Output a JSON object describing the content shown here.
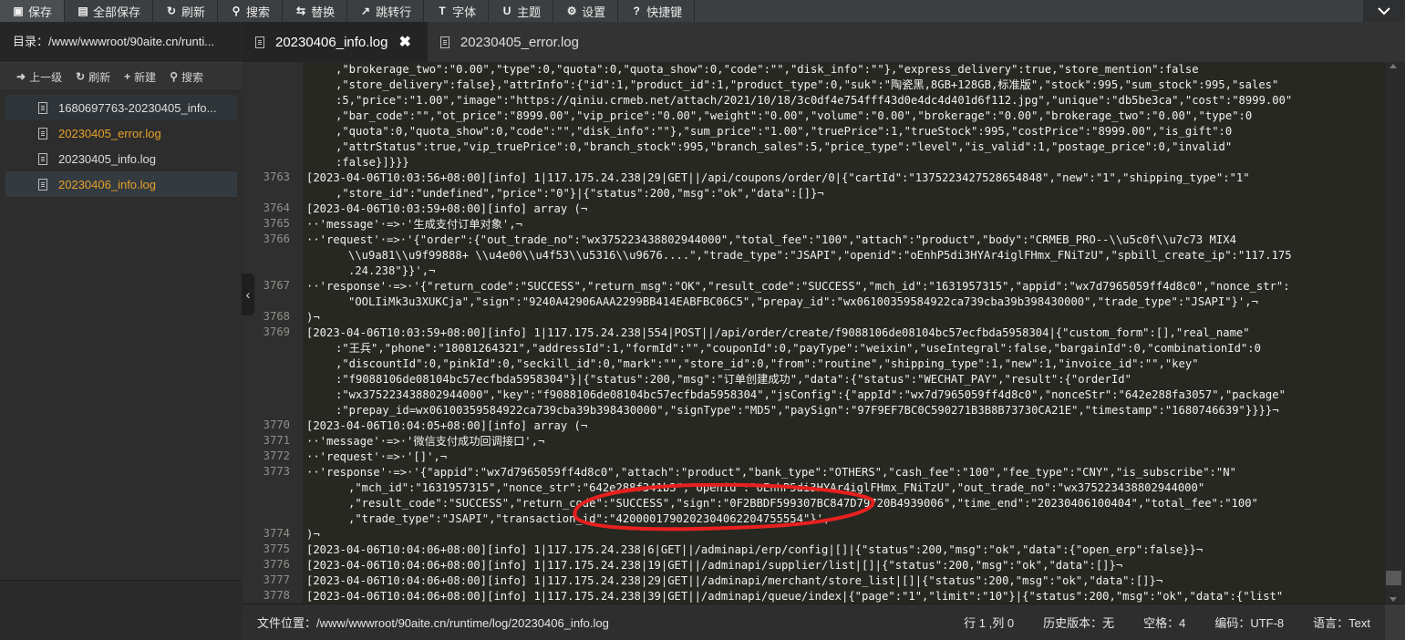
{
  "toolbar": {
    "buttons": [
      {
        "icon": "save-icon",
        "label": "保存"
      },
      {
        "icon": "save-all-icon",
        "label": "全部保存"
      },
      {
        "icon": "refresh-icon",
        "label": "刷新"
      },
      {
        "icon": "search-icon",
        "label": "搜索"
      },
      {
        "icon": "replace-icon",
        "label": "替换"
      },
      {
        "icon": "goto-line-icon",
        "label": "跳转行"
      },
      {
        "icon": "font-icon",
        "label": "字体"
      },
      {
        "icon": "theme-icon",
        "label": "主题"
      },
      {
        "icon": "settings-icon",
        "label": "设置"
      },
      {
        "icon": "help-icon",
        "label": "快捷键"
      }
    ]
  },
  "sidebar": {
    "dir_label": "目录：/www/wwwroot/90aite.cn/runti...",
    "actions": [
      {
        "icon": "up-arrow-icon",
        "label": "上一级"
      },
      {
        "icon": "refresh-icon",
        "label": "刷新"
      },
      {
        "icon": "plus-icon",
        "label": "新建"
      },
      {
        "icon": "search-icon",
        "label": "搜索"
      }
    ],
    "files": [
      {
        "name": "1680697763-20230405_info...",
        "highlight": false
      },
      {
        "name": "20230405_error.log",
        "highlight": true
      },
      {
        "name": "20230405_info.log",
        "highlight": false
      },
      {
        "name": "20230406_info.log",
        "highlight": true
      }
    ]
  },
  "tabs": [
    {
      "label": "20230406_info.log",
      "active": true,
      "close": "✖"
    },
    {
      "label": "20230405_error.log",
      "active": false
    }
  ],
  "editor": {
    "line_numbers": [
      "3763",
      "3764",
      "3765",
      "3766",
      "3767",
      "3768",
      "3769",
      "3770",
      "3771",
      "3772",
      "3773",
      "3774",
      "3775",
      "3776",
      "3777",
      "3778"
    ],
    "lines": [
      ",\"brokerage_two\":\"0.00\",\"type\":0,\"quota\":0,\"quota_show\":0,\"code\":\"\",\"disk_info\":\"\"},\"express_delivery\":true,\"store_mention\":false",
      ",\"store_delivery\":false},\"attrInfo\":{\"id\":1,\"product_id\":1,\"product_type\":0,\"suk\":\"陶瓷黑,8GB+128GB,标准版\",\"stock\":995,\"sum_stock\":995,\"sales\"",
      ":5,\"price\":\"1.00\",\"image\":\"https://qiniu.crmeb.net/attach/2021/10/18/3c0df4e754fff43d0e4dc4d401d6f112.jpg\",\"unique\":\"db5be3ca\",\"cost\":\"8999.00\"",
      ",\"bar_code\":\"\",\"ot_price\":\"8999.00\",\"vip_price\":\"0.00\",\"weight\":\"0.00\",\"volume\":\"0.00\",\"brokerage\":\"0.00\",\"brokerage_two\":\"0.00\",\"type\":0",
      ",\"quota\":0,\"quota_show\":0,\"code\":\"\",\"disk_info\":\"\"},\"sum_price\":\"1.00\",\"truePrice\":1,\"trueStock\":995,\"costPrice\":\"8999.00\",\"is_gift\":0",
      ",\"attrStatus\":true,\"vip_truePrice\":0,\"branch_stock\":995,\"branch_sales\":5,\"price_type\":\"level\",\"is_valid\":1,\"postage_price\":0,\"invalid\"",
      ":false}]}}}",
      "[2023-04-06T10:03:56+08:00][info] 1|117.175.24.238|29|GET||/api/coupons/order/0|{\"cartId\":\"1375223427528654848\",\"new\":\"1\",\"shipping_type\":\"1\"",
      ",\"store_id\":\"undefined\",\"price\":\"0\"}|{\"status\":200,\"msg\":\"ok\",\"data\":[]}¬",
      "[2023-04-06T10:03:59+08:00][info] array (¬",
      "··'message'·=>·'生成支付订单对象',¬",
      "··'request'·=>·'{\"order\":{\"out_trade_no\":\"wx375223438802944000\",\"total_fee\":\"100\",\"attach\":\"product\",\"body\":\"CRMEB_PRO--\\\\u5c0f\\\\u7c73 MIX4",
      "\\\\u9a81\\\\u9f99888+ \\\\u4e00\\\\u4f53\\\\u5316\\\\u9676....\",\"trade_type\":\"JSAPI\",\"openid\":\"oEnhP5di3HYAr4iglFHmx_FNiTzU\",\"spbill_create_ip\":\"117.175",
      ".24.238\"}}',¬",
      "··'response'·=>·'{\"return_code\":\"SUCCESS\",\"return_msg\":\"OK\",\"result_code\":\"SUCCESS\",\"mch_id\":\"1631957315\",\"appid\":\"wx7d7965059ff4d8c0\",\"nonce_str\":",
      "\"OOLIiMk3u3XUKCja\",\"sign\":\"9240A42906AAA2299BB414EABFBC06C5\",\"prepay_id\":\"wx06100359584922ca739cba39b398430000\",\"trade_type\":\"JSAPI\"}',¬",
      ")¬",
      "[2023-04-06T10:03:59+08:00][info] 1|117.175.24.238|554|POST||/api/order/create/f9088106de08104bc57ecfbda5958304|{\"custom_form\":[],\"real_name\"",
      ":\"王兵\",\"phone\":\"18081264321\",\"addressId\":1,\"formId\":\"\",\"couponId\":0,\"payType\":\"weixin\",\"useIntegral\":false,\"bargainId\":0,\"combinationId\":0",
      ",\"discountId\":0,\"pinkId\":0,\"seckill_id\":0,\"mark\":\"\",\"store_id\":0,\"from\":\"routine\",\"shipping_type\":1,\"new\":1,\"invoice_id\":\"\",\"key\"",
      ":\"f9088106de08104bc57ecfbda5958304\"}|{\"status\":200,\"msg\":\"订单创建成功\",\"data\":{\"status\":\"WECHAT_PAY\",\"result\":{\"orderId\"",
      ":\"wx375223438802944000\",\"key\":\"f9088106de08104bc57ecfbda5958304\",\"jsConfig\":{\"appId\":\"wx7d7965059ff4d8c0\",\"nonceStr\":\"642e288fa3057\",\"package\"",
      ":\"prepay_id=wx06100359584922ca739cba39b398430000\",\"signType\":\"MD5\",\"paySign\":\"97F9EF7BC0C590271B3B8B73730CA21E\",\"timestamp\":\"1680746639\"}}}}¬",
      "[2023-04-06T10:04:05+08:00][info] array (¬",
      "··'message'·=>·'微信支付成功回调接口',¬",
      "··'request'·=>·'[]',¬",
      "··'response'·=>·'{\"appid\":\"wx7d7965059ff4d8c0\",\"attach\":\"product\",\"bank_type\":\"OTHERS\",\"cash_fee\":\"100\",\"fee_type\":\"CNY\",\"is_subscribe\":\"N\"",
      ",\"mch_id\":\"1631957315\",\"nonce_str\":\"642e288f341b3\",\"openid\":\"oEnhP5di3HYAr4iglFHmx_FNiTzU\",\"out_trade_no\":\"wx375223438802944000\"",
      ",\"result_code\":\"SUCCESS\",\"return_code\":\"SUCCESS\",\"sign\":\"0F2BBDF599307BC847D79720B4939006\",\"time_end\":\"20230406100404\",\"total_fee\":\"100\"",
      ",\"trade_type\":\"JSAPI\",\"transaction_id\":\"4200001790202304062204755554\"}',¬",
      ")¬",
      "[2023-04-06T10:04:06+08:00][info] 1|117.175.24.238|6|GET||/adminapi/erp/config|[]|{\"status\":200,\"msg\":\"ok\",\"data\":{\"open_erp\":false}}¬",
      "[2023-04-06T10:04:06+08:00][info] 1|117.175.24.238|19|GET||/adminapi/supplier/list|[]|{\"status\":200,\"msg\":\"ok\",\"data\":[]}¬",
      "[2023-04-06T10:04:06+08:00][info] 1|117.175.24.238|29|GET||/adminapi/merchant/store_list|[]|{\"status\":200,\"msg\":\"ok\",\"data\":[]}¬",
      "[2023-04-06T10:04:06+08:00][info] 1|117.175.24.238|39|GET||/adminapi/queue/index|{\"page\":\"1\",\"limit\":\"10\"}|{\"status\":200,\"msg\":\"ok\",\"data\":{\"list\""
    ]
  },
  "statusbar": {
    "path": "文件位置：/www/wwwroot/90aite.cn/runtime/log/20230406_info.log",
    "position": "行 1 ,列 0",
    "history": "历史版本：无",
    "indent": "空格：4",
    "encoding": "编码：UTF-8",
    "language": "语言：Text"
  },
  "colors": {
    "highlight_file": "#e6a12b",
    "annotation": "#e8201e"
  }
}
